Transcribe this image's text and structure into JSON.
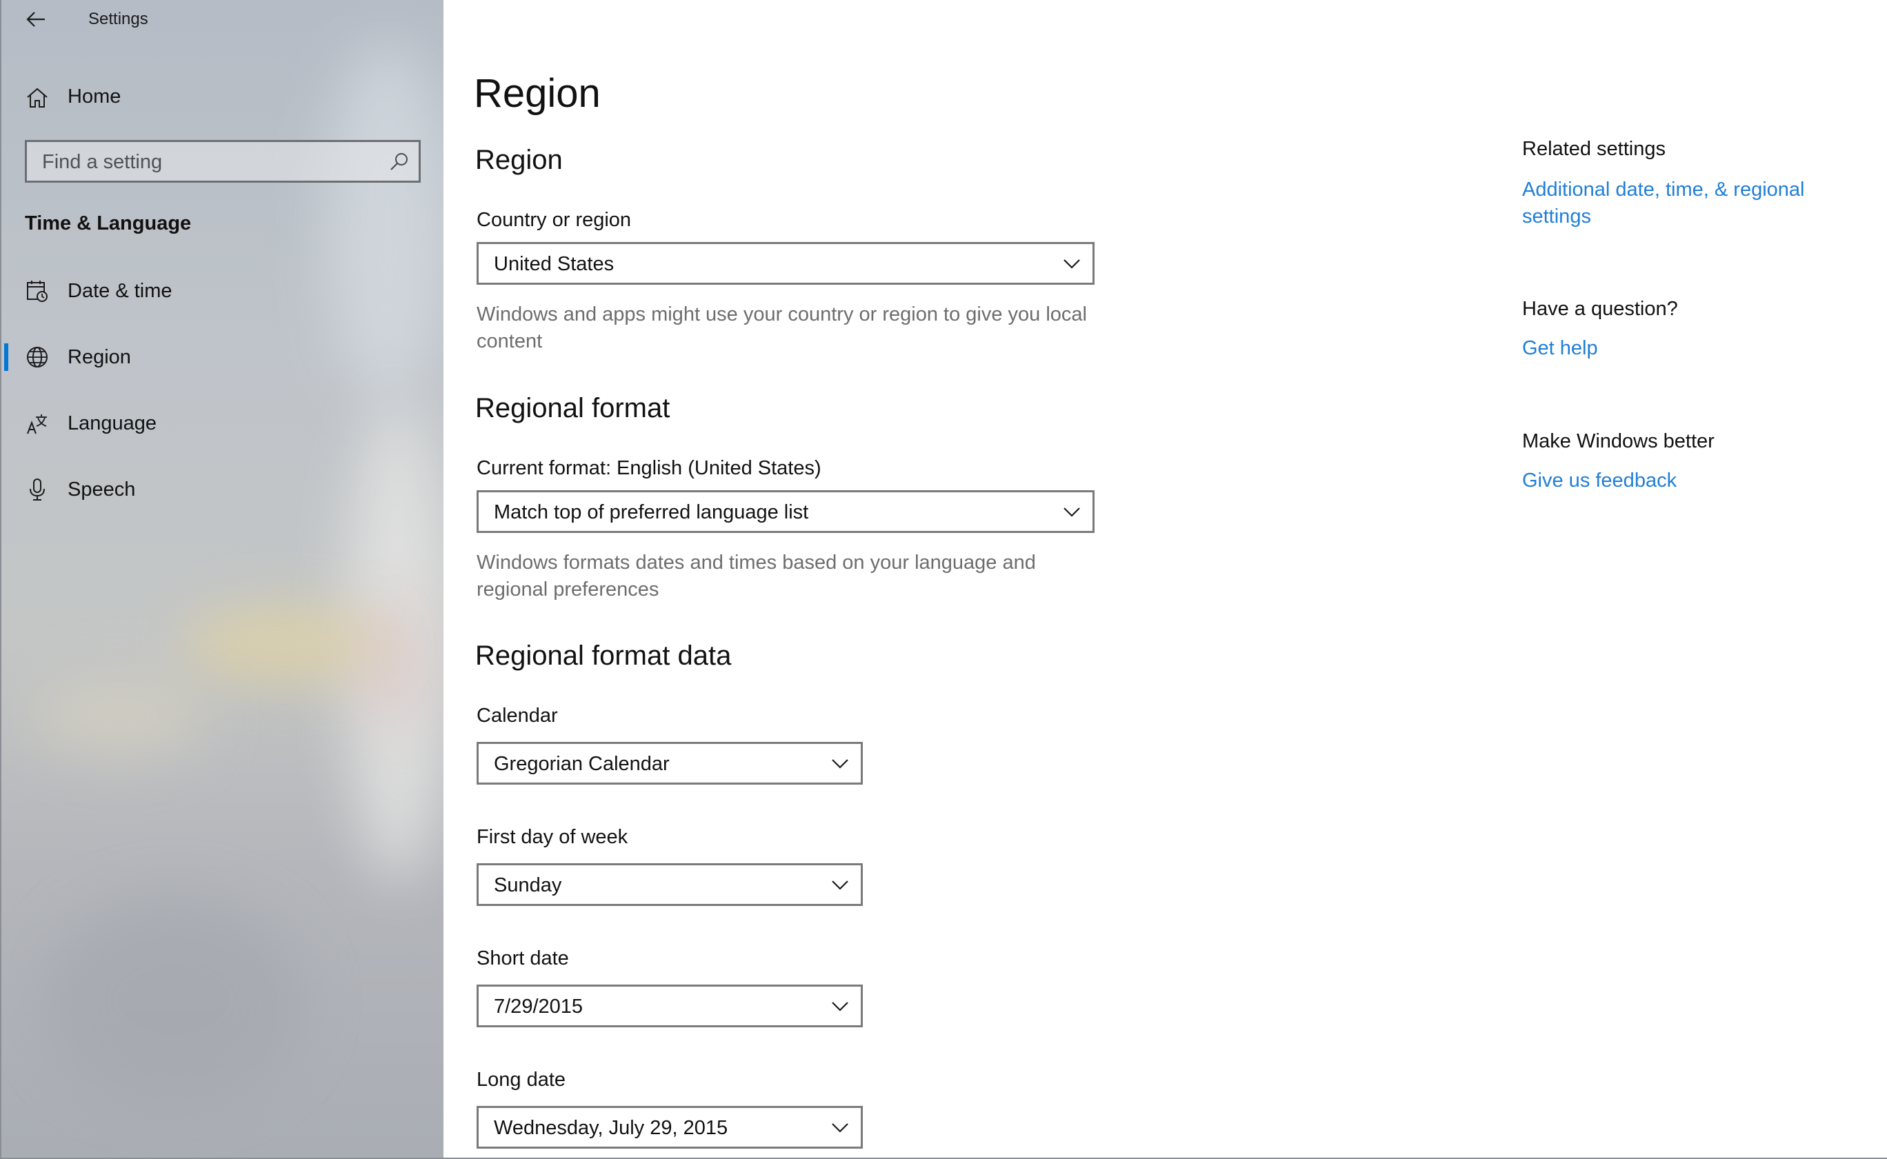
{
  "window": {
    "app_title": "Settings"
  },
  "sidebar": {
    "home_label": "Home",
    "search": {
      "placeholder": "Find a setting"
    },
    "section_heading": "Time & Language",
    "items": [
      {
        "label": "Date & time",
        "icon": "calendar-clock-icon"
      },
      {
        "label": "Region",
        "icon": "globe-icon",
        "active": true
      },
      {
        "label": "Language",
        "icon": "language-icon"
      },
      {
        "label": "Speech",
        "icon": "microphone-icon"
      }
    ]
  },
  "main": {
    "page_title": "Region",
    "region": {
      "heading": "Region",
      "country_label": "Country or region",
      "country_value": "United States",
      "country_help": "Windows and apps might use your country or region to give you local content"
    },
    "regional_format": {
      "heading": "Regional format",
      "current_label": "Current format: English (United States)",
      "format_value": "Match top of preferred language list",
      "format_help": "Windows formats dates and times based on your language and regional preferences"
    },
    "regional_format_data": {
      "heading": "Regional format data",
      "calendar_label": "Calendar",
      "calendar_value": "Gregorian Calendar",
      "first_day_label": "First day of week",
      "first_day_value": "Sunday",
      "short_date_label": "Short date",
      "short_date_value": "7/29/2015",
      "long_date_label": "Long date",
      "long_date_value": "Wednesday, July 29, 2015"
    }
  },
  "right_column": {
    "related_heading": "Related settings",
    "related_link": "Additional date, time, & regional settings",
    "question_heading": "Have a question?",
    "help_link": "Get help",
    "better_heading": "Make Windows better",
    "feedback_link": "Give us feedback"
  },
  "colors": {
    "accent": "#0078d7",
    "link": "#1f7ed6",
    "help_text": "#6d6d6d",
    "control_border": "#7a7a7a"
  }
}
